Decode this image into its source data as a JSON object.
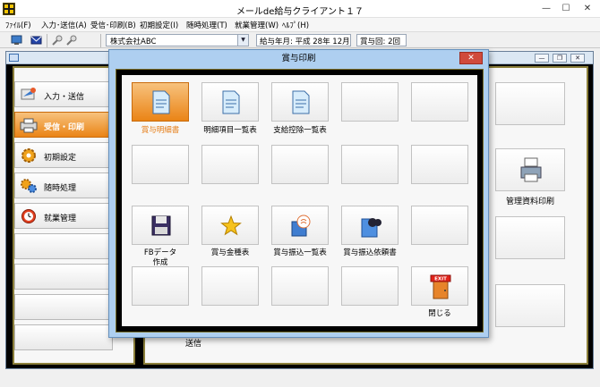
{
  "window": {
    "title": "メールde給与クライアント１７",
    "minimize": "—",
    "maximize": "☐",
    "close": "✕"
  },
  "menu": [
    "ﾌｧｲﾙ(F)",
    "入力･送信(A)",
    "受信･印刷(B)",
    "初期設定(I)",
    "随時処理(T)",
    "就業管理(W)",
    "ﾍﾙﾌﾟ(H)"
  ],
  "toolbar": {
    "company": "株式会社ABC",
    "payroll_month": "給与年月: 平成 28年 12月",
    "bonus_count": "賞与回: 2回"
  },
  "sidebar": {
    "items": [
      {
        "label": "入力・送信",
        "icon": "input-send-icon"
      },
      {
        "label": "受信・印刷",
        "icon": "receive-print-icon",
        "active": true
      },
      {
        "label": "初期設定",
        "icon": "gear-icon"
      },
      {
        "label": "随時処理",
        "icon": "gears-icon"
      },
      {
        "label": "就業管理",
        "icon": "clock-icon"
      }
    ]
  },
  "behind": {
    "report_print_label": "管理資料印刷",
    "send_label": "送信"
  },
  "dialog": {
    "title": "賞与印刷",
    "close": "✕",
    "tiles": [
      {
        "label": "賞与明細書",
        "icon": "document-icon",
        "active": true
      },
      {
        "label": "明細項目一覧表",
        "icon": "document-icon"
      },
      {
        "label": "支給控除一覧表",
        "icon": "document-icon"
      },
      {
        "label": "FBデータ",
        "label2": "作成",
        "icon": "floppy-disk-icon"
      },
      {
        "label": "賞与金種表",
        "icon": "star-icon"
      },
      {
        "label": "賞与振込一覧表",
        "icon": "bank-transfer-icon"
      },
      {
        "label": "賞与振込依頼書",
        "icon": "quote-document-icon"
      },
      {
        "label": "閉じる",
        "icon": "exit-door-icon",
        "badge": "EXIT"
      }
    ]
  },
  "colors": {
    "accent_orange": "#ea8416",
    "dialog_blue": "#aecff0",
    "panel_border": "#8b7f3a"
  }
}
